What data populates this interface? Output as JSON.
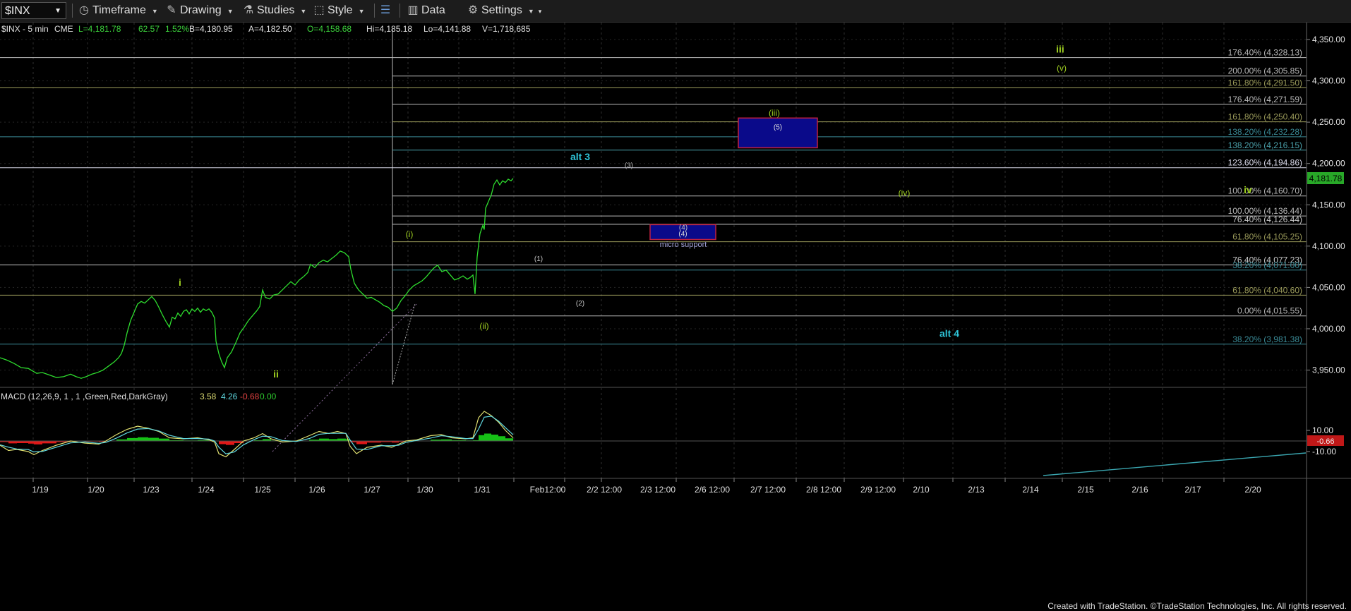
{
  "toolbar": {
    "symbol": "$INX",
    "timeframe": "Timeframe",
    "drawing": "Drawing",
    "studies": "Studies",
    "style": "Style",
    "data": "Data",
    "settings": "Settings"
  },
  "header": {
    "symbol": "$INX - 5 min",
    "exchange": "CME",
    "last": "L=4,181.78",
    "change": "62.57",
    "change_pct": "1.52%",
    "bid": "B=4,180.95",
    "ask": "A=4,182.50",
    "open": "O=4,158.68",
    "high": "Hi=4,185.18",
    "low": "Lo=4,141.88",
    "volume": "V=1,718,685"
  },
  "macd": {
    "label": "MACD (12,26,9, 1 , 1 ,Green,Red,DarkGray)",
    "v1": "3.58",
    "v2": "4.26",
    "v3": "-0.68",
    "v4": "0.00",
    "tag": "-0.66"
  },
  "price_tag": "4,181.78",
  "footer": "Created with TradeStation. ©TradeStation Technologies, Inc. All rights reserved.",
  "chart_data": {
    "type": "line",
    "x_tick_labels": [
      "1/19",
      "1/20",
      "1/23",
      "1/24",
      "1/25",
      "1/26",
      "1/27",
      "1/30",
      "1/31",
      "Feb12:00",
      "2/2 12:00",
      "2/3 12:00",
      "2/6 12:00",
      "2/7 12:00",
      "2/8 12:00",
      "2/9 12:00",
      "2/10",
      "2/13",
      "2/14",
      "2/15",
      "2/16",
      "2/17",
      "2/20"
    ],
    "y_tick_labels": [
      "4,350.00",
      "4,300.00",
      "4,250.00",
      "4,200.00",
      "4,150.00",
      "4,100.00",
      "4,050.00",
      "4,000.00",
      "3,950.00"
    ],
    "ylim": [
      3935,
      4358
    ],
    "macd_tick_labels": [
      "10.00",
      "-10.00"
    ],
    "price_path": [
      [
        0,
        3965
      ],
      [
        10,
        3962
      ],
      [
        20,
        3958
      ],
      [
        30,
        3953
      ],
      [
        40,
        3952
      ],
      [
        48,
        3948
      ],
      [
        52,
        3946
      ],
      [
        60,
        3947
      ],
      [
        70,
        3944
      ],
      [
        80,
        3941
      ],
      [
        90,
        3942
      ],
      [
        100,
        3945
      ],
      [
        108,
        3942
      ],
      [
        115,
        3940
      ],
      [
        122,
        3942
      ],
      [
        130,
        3945
      ],
      [
        138,
        3947
      ],
      [
        146,
        3950
      ],
      [
        154,
        3955
      ],
      [
        162,
        3960
      ],
      [
        168,
        3965
      ],
      [
        172,
        3970
      ],
      [
        176,
        3980
      ],
      [
        180,
        3995
      ],
      [
        185,
        4010
      ],
      [
        190,
        4020
      ],
      [
        195,
        4030
      ],
      [
        200,
        4033
      ],
      [
        205,
        4031
      ],
      [
        210,
        4035
      ],
      [
        215,
        4039
      ],
      [
        220,
        4034
      ],
      [
        225,
        4026
      ],
      [
        230,
        4017
      ],
      [
        235,
        4009
      ],
      [
        240,
        4002
      ],
      [
        244,
        4014
      ],
      [
        248,
        4012
      ],
      [
        252,
        4019
      ],
      [
        256,
        4015
      ],
      [
        260,
        4021
      ],
      [
        264,
        4023
      ],
      [
        268,
        4018
      ],
      [
        272,
        4024
      ],
      [
        276,
        4021
      ],
      [
        280,
        4025
      ],
      [
        284,
        4020
      ],
      [
        288,
        4024
      ],
      [
        292,
        4022
      ],
      [
        296,
        4024
      ],
      [
        300,
        4020
      ],
      [
        304,
        4013
      ],
      [
        306,
        3985
      ],
      [
        310,
        3970
      ],
      [
        314,
        3960
      ],
      [
        318,
        3953
      ],
      [
        322,
        3965
      ],
      [
        328,
        3972
      ],
      [
        334,
        3983
      ],
      [
        340,
        3995
      ],
      [
        346,
        4002
      ],
      [
        352,
        4010
      ],
      [
        358,
        4016
      ],
      [
        364,
        4022
      ],
      [
        368,
        4027
      ],
      [
        372,
        4047
      ],
      [
        376,
        4038
      ],
      [
        382,
        4036
      ],
      [
        388,
        4041
      ],
      [
        394,
        4042
      ],
      [
        400,
        4047
      ],
      [
        406,
        4052
      ],
      [
        412,
        4057
      ],
      [
        418,
        4053
      ],
      [
        424,
        4059
      ],
      [
        430,
        4063
      ],
      [
        436,
        4068
      ],
      [
        440,
        4078
      ],
      [
        446,
        4074
      ],
      [
        452,
        4080
      ],
      [
        458,
        4083
      ],
      [
        464,
        4081
      ],
      [
        470,
        4085
      ],
      [
        476,
        4089
      ],
      [
        482,
        4094
      ],
      [
        488,
        4092
      ],
      [
        494,
        4087
      ],
      [
        497,
        4072
      ],
      [
        502,
        4055
      ],
      [
        508,
        4047
      ],
      [
        514,
        4042
      ],
      [
        520,
        4037
      ],
      [
        526,
        4038
      ],
      [
        532,
        4035
      ],
      [
        538,
        4032
      ],
      [
        544,
        4028
      ],
      [
        550,
        4026
      ],
      [
        556,
        4021
      ],
      [
        562,
        4025
      ],
      [
        568,
        4034
      ],
      [
        574,
        4040
      ],
      [
        580,
        4047
      ],
      [
        586,
        4052
      ],
      [
        592,
        4055
      ],
      [
        598,
        4058
      ],
      [
        604,
        4063
      ],
      [
        610,
        4069
      ],
      [
        614,
        4073
      ],
      [
        620,
        4077
      ],
      [
        626,
        4069
      ],
      [
        632,
        4071
      ],
      [
        638,
        4065
      ],
      [
        644,
        4059
      ],
      [
        650,
        4061
      ],
      [
        656,
        4064
      ],
      [
        662,
        4060
      ],
      [
        666,
        4062
      ],
      [
        670,
        4065
      ],
      [
        673,
        4042
      ],
      [
        676,
        4087
      ],
      [
        680,
        4115
      ],
      [
        684,
        4125
      ],
      [
        686,
        4120
      ],
      [
        688,
        4146
      ],
      [
        692,
        4154
      ],
      [
        696,
        4162
      ],
      [
        700,
        4175
      ],
      [
        704,
        4180
      ],
      [
        708,
        4174
      ],
      [
        712,
        4179
      ],
      [
        716,
        4177
      ],
      [
        720,
        4181
      ],
      [
        724,
        4179
      ],
      [
        727,
        4182
      ]
    ],
    "macd_path": [
      [
        0,
        -4
      ],
      [
        12,
        -9
      ],
      [
        24,
        -8
      ],
      [
        40,
        -10
      ],
      [
        48,
        -13
      ],
      [
        60,
        -9
      ],
      [
        80,
        -4
      ],
      [
        100,
        0
      ],
      [
        120,
        -2
      ],
      [
        140,
        -3
      ],
      [
        150,
        0
      ],
      [
        165,
        6
      ],
      [
        180,
        11
      ],
      [
        195,
        14
      ],
      [
        210,
        12
      ],
      [
        225,
        9
      ],
      [
        240,
        3
      ],
      [
        260,
        2
      ],
      [
        280,
        3
      ],
      [
        296,
        1
      ],
      [
        304,
        -1
      ],
      [
        310,
        -12
      ],
      [
        320,
        -15
      ],
      [
        332,
        -8
      ],
      [
        345,
        0
      ],
      [
        360,
        3
      ],
      [
        372,
        7
      ],
      [
        384,
        2
      ],
      [
        400,
        -1
      ],
      [
        420,
        0
      ],
      [
        438,
        5
      ],
      [
        452,
        9
      ],
      [
        466,
        7
      ],
      [
        478,
        9
      ],
      [
        490,
        7
      ],
      [
        496,
        -5
      ],
      [
        505,
        -12
      ],
      [
        520,
        -6
      ],
      [
        540,
        -4
      ],
      [
        555,
        -6
      ],
      [
        565,
        -3
      ],
      [
        575,
        0
      ],
      [
        590,
        1
      ],
      [
        610,
        5
      ],
      [
        625,
        6
      ],
      [
        640,
        3
      ],
      [
        660,
        2
      ],
      [
        670,
        3
      ],
      [
        678,
        22
      ],
      [
        686,
        28
      ],
      [
        696,
        24
      ],
      [
        706,
        18
      ],
      [
        716,
        10
      ],
      [
        727,
        3
      ]
    ],
    "fib_levels": [
      {
        "label": "176.40% (4,328.13)",
        "value": 4328.13,
        "color": "#b8b8b8"
      },
      {
        "label": "200.00% (4,305.85)",
        "value": 4305.85,
        "color": "#b8b8b8"
      },
      {
        "label": "161.80% (4,291.50)",
        "value": 4291.5,
        "color": "#9a9a5a"
      },
      {
        "label": "176.40% (4,271.59)",
        "value": 4271.59,
        "color": "#b8b8b8"
      },
      {
        "label": "161.80% (4,250.40)",
        "value": 4250.4,
        "color": "#9a9a5a"
      },
      {
        "label": "138.20% (4,232.28)",
        "value": 4232.28,
        "color": "#3a8a96"
      },
      {
        "label": "138.20% (4,216.15)",
        "value": 4216.15,
        "color": "#4aa0aa"
      },
      {
        "label": "123.60% (4,194.86)",
        "value": 4194.86,
        "color": "#d8d8e8"
      },
      {
        "label": "100.00% (4,160.70)",
        "value": 4160.7,
        "color": "#b8b8b8"
      },
      {
        "label": "100.00% (4,136.44)",
        "value": 4136.44,
        "color": "#b8b8b8"
      },
      {
        "label": "76.40% (4,126.44)",
        "value": 4126.44,
        "color": "#c8c8c8"
      },
      {
        "label": "61.80% (4,105.25)",
        "value": 4105.25,
        "color": "#9a9a5a"
      },
      {
        "label": "76.40% (4,077.23)",
        "value": 4077.23,
        "color": "#c8c8c8"
      },
      {
        "label": "38.20% (4,071.00)",
        "value": 4071.0,
        "color": "#3a8a96"
      },
      {
        "label": "61.80% (4,040.60)",
        "value": 4040.6,
        "color": "#9a9a5a"
      },
      {
        "label": "0.00% (4,015.55)",
        "value": 4015.55,
        "color": "#b8b8b8"
      },
      {
        "label": "38.20% (3,981.38)",
        "value": 3981.38,
        "color": "#3a8a96"
      }
    ],
    "support_boxes": [
      {
        "name": "box-5",
        "label": "(5)",
        "y_top": 4255,
        "y_bottom": 4219
      },
      {
        "name": "box-4",
        "label": "(4)",
        "y_top": 4126,
        "y_bottom": 4108
      }
    ],
    "wave_labels": [
      {
        "text": "iii",
        "color": "#9fd020",
        "size": 14,
        "bold": true,
        "value": 4334
      },
      {
        "text": "(v)",
        "color": "#9fd020",
        "size": 12,
        "bold": false,
        "value": 4312
      },
      {
        "text": "(iii)",
        "color": "#9fd020",
        "size": 12,
        "bold": false,
        "value": 4258
      },
      {
        "text": "alt 3",
        "color": "#2ec4d8",
        "size": 14,
        "bold": true,
        "value": 4204
      },
      {
        "text": "(3)",
        "color": "#b8b8b8",
        "size": 10,
        "bold": false,
        "value": 4195
      },
      {
        "text": "(iv)",
        "color": "#9fd020",
        "size": 12,
        "bold": false,
        "value": 4161
      },
      {
        "text": "iv",
        "color": "#9fd020",
        "size": 14,
        "bold": true,
        "value": 4164
      },
      {
        "text": "(4)",
        "color": "#c8c8c8",
        "size": 10,
        "bold": false,
        "value": 4120
      },
      {
        "text": "micro support",
        "color": "#a0a0d8",
        "size": 11,
        "bold": false,
        "value": 4099
      },
      {
        "text": "(i)",
        "color": "#9fd020",
        "size": 12,
        "bold": false,
        "value": 4111
      },
      {
        "text": "(1)",
        "color": "#c8c8c8",
        "size": 10,
        "bold": false,
        "value": 4082
      },
      {
        "text": "i",
        "color": "#9fd020",
        "size": 14,
        "bold": true,
        "value": 4052
      },
      {
        "text": "(2)",
        "color": "#c8c8c8",
        "size": 10,
        "bold": false,
        "value": 4028
      },
      {
        "text": "(ii)",
        "color": "#9fd020",
        "size": 12,
        "bold": false,
        "value": 4000
      },
      {
        "text": "alt 4",
        "color": "#2ec4d8",
        "size": 14,
        "bold": true,
        "value": 3990
      },
      {
        "text": "ii",
        "color": "#9fd020",
        "size": 14,
        "bold": true,
        "value": 3941
      }
    ]
  }
}
